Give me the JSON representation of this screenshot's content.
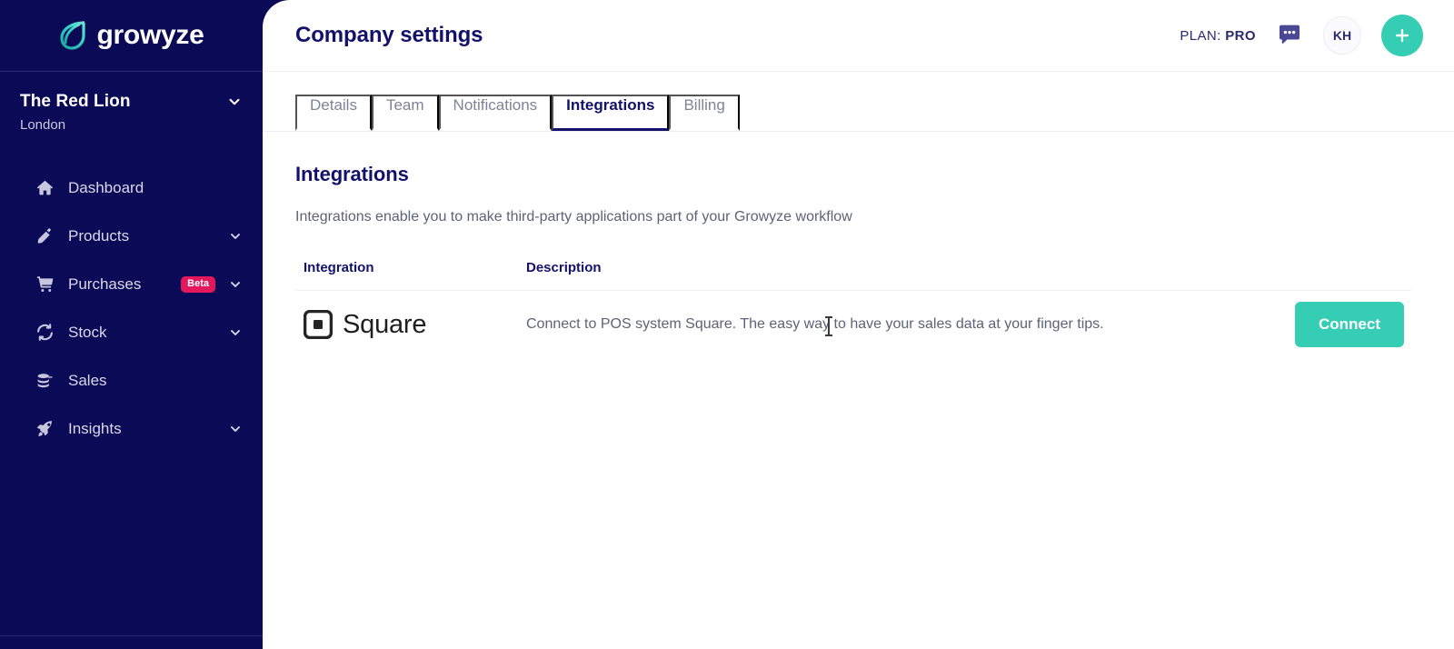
{
  "brand": {
    "name": "growyze",
    "logo_icon": "growyze-leaf-g-logo"
  },
  "sidebar": {
    "org": {
      "name": "The Red Lion",
      "city": "London",
      "caret_icon": "chevron-down-icon"
    },
    "items": [
      {
        "label": "Dashboard",
        "icon": "home-icon",
        "badge": null,
        "caret": false
      },
      {
        "label": "Products",
        "icon": "bottle-icon",
        "badge": null,
        "caret": true
      },
      {
        "label": "Purchases",
        "icon": "shopping-cart-icon",
        "badge": "Beta",
        "caret": true
      },
      {
        "label": "Stock",
        "icon": "sync-refresh-icon",
        "badge": null,
        "caret": true
      },
      {
        "label": "Sales",
        "icon": "coins-stack-icon",
        "badge": null,
        "caret": false
      },
      {
        "label": "Insights",
        "icon": "rocket-icon",
        "badge": null,
        "caret": true
      }
    ]
  },
  "topbar": {
    "title": "Company settings",
    "plan_label": "PLAN:",
    "plan_value": "PRO",
    "chat_icon": "chat-bubble-icon",
    "avatar_initials": "KH",
    "add_icon": "plus-icon"
  },
  "tabs": [
    {
      "label": "Details",
      "active": false
    },
    {
      "label": "Team",
      "active": false
    },
    {
      "label": "Notifications",
      "active": false
    },
    {
      "label": "Integrations",
      "active": true
    },
    {
      "label": "Billing",
      "active": false
    }
  ],
  "content": {
    "heading": "Integrations",
    "subheading": "Integrations enable you to make third-party applications part of your Growyze workflow",
    "table": {
      "columns": [
        "Integration",
        "Description"
      ],
      "rows": [
        {
          "integration_name": "Square",
          "integration_icon": "square-logo-icon",
          "description": "Connect to POS system Square. The easy way to have your sales data at your finger tips.",
          "action_label": "Connect"
        }
      ]
    }
  },
  "colors": {
    "sidebar_bg": "#0a0a57",
    "accent_teal": "#35cdb4",
    "navy_text": "#13116b",
    "badge_pink": "#e2175c"
  }
}
